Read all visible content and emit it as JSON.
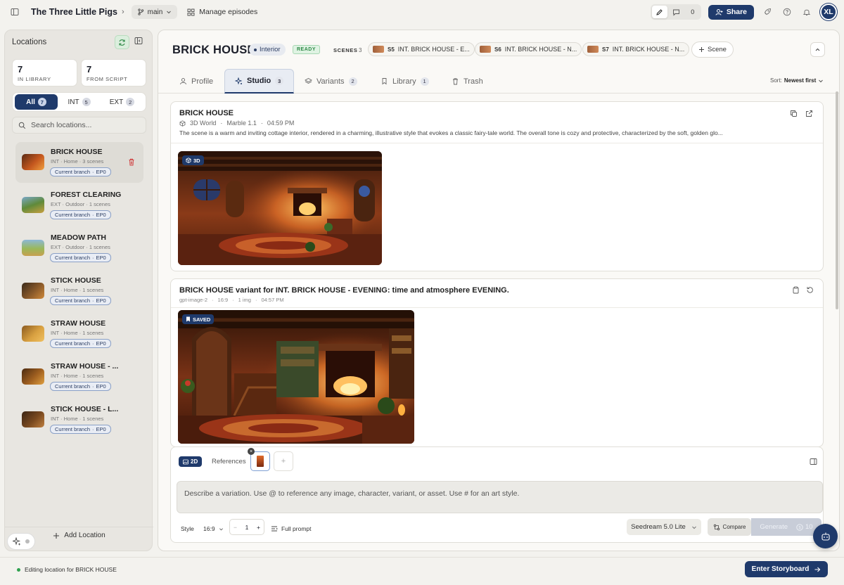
{
  "topbar": {
    "project_title": "The Three Little Pigs",
    "branch": "main",
    "manage_label": "Manage episodes",
    "comment_count": "0",
    "share_label": "Share",
    "avatar_initials": "XL"
  },
  "sidebar": {
    "title": "Locations",
    "stats": [
      {
        "value": "7",
        "label": "IN LIBRARY"
      },
      {
        "value": "7",
        "label": "FROM SCRIPT"
      }
    ],
    "filters": [
      {
        "label": "All",
        "count": "7"
      },
      {
        "label": "INT",
        "count": "5"
      },
      {
        "label": "EXT",
        "count": "2"
      }
    ],
    "search_placeholder": "Search locations...",
    "items": [
      {
        "name": "BRICK HOUSE",
        "meta": "INT · Home · 3 scenes",
        "tag": "Current branch",
        "ep": "EP0"
      },
      {
        "name": "FOREST CLEARING",
        "meta": "EXT · Outdoor · 1 scenes",
        "tag": "Current branch",
        "ep": "EP0"
      },
      {
        "name": "MEADOW PATH",
        "meta": "EXT · Outdoor · 1 scenes",
        "tag": "Current branch",
        "ep": "EP0"
      },
      {
        "name": "STICK HOUSE",
        "meta": "INT · Home · 1 scenes",
        "tag": "Current branch",
        "ep": "EP0"
      },
      {
        "name": "STRAW HOUSE",
        "meta": "INT · Home · 1 scenes",
        "tag": "Current branch",
        "ep": "EP0"
      },
      {
        "name": "STRAW HOUSE - ...",
        "meta": "INT · Home · 1 scenes",
        "tag": "Current branch",
        "ep": "EP0"
      },
      {
        "name": "STICK HOUSE - L...",
        "meta": "INT · Home · 1 scenes",
        "tag": "Current branch",
        "ep": "EP0"
      }
    ],
    "add_label": "Add Location"
  },
  "header": {
    "title": "BRICK HOUSE",
    "type_pill": "Interior",
    "status_pill": "READY",
    "scenes_label": "SCENES",
    "scenes_count": "3",
    "scenes": [
      {
        "num": "S5",
        "label": "INT. BRICK HOUSE - E..."
      },
      {
        "num": "S6",
        "label": "INT. BRICK HOUSE - N..."
      },
      {
        "num": "S7",
        "label": "INT. BRICK HOUSE - N..."
      }
    ],
    "add_scene_label": "Scene"
  },
  "tabs": [
    {
      "label": "Profile",
      "count": ""
    },
    {
      "label": "Studio",
      "count": "3"
    },
    {
      "label": "Variants",
      "count": "2"
    },
    {
      "label": "Library",
      "count": "1"
    },
    {
      "label": "Trash",
      "count": ""
    }
  ],
  "sort": {
    "label": "Sort:",
    "value": "Newest first"
  },
  "cards": [
    {
      "title": "BRICK HOUSE",
      "kind": "3D World",
      "model": "Marble 1.1",
      "time": "04:59 PM",
      "desc": "The scene is a warm and inviting cottage interior, rendered in a charming, illustrative style that evokes a classic fairy-tale world. The overall tone is cozy and protective, characterized by the soft, golden glo...",
      "badge": "3D"
    },
    {
      "title": "BRICK HOUSE variant for INT. BRICK HOUSE - EVENING: time and atmosphere EVENING.",
      "model": "gpt-image-2",
      "ratio": "16:9",
      "imgs": "1 img",
      "time": "04:57 PM",
      "badge": "SAVED"
    }
  ],
  "composer": {
    "mode": "2D",
    "references_label": "References",
    "placeholder": "Describe a variation. Use @ to reference any image, character, variant, or asset. Use # for an art style.",
    "style_label": "Style",
    "ratio": "16:9",
    "count": "1",
    "full_prompt_label": "Full prompt",
    "model": "Seedream 5.0 Lite",
    "compare_label": "Compare",
    "generate_label": "Generate",
    "cost": "10"
  },
  "footer": {
    "status": "Editing location for BRICK HOUSE",
    "enter_label": "Enter Storyboard"
  }
}
